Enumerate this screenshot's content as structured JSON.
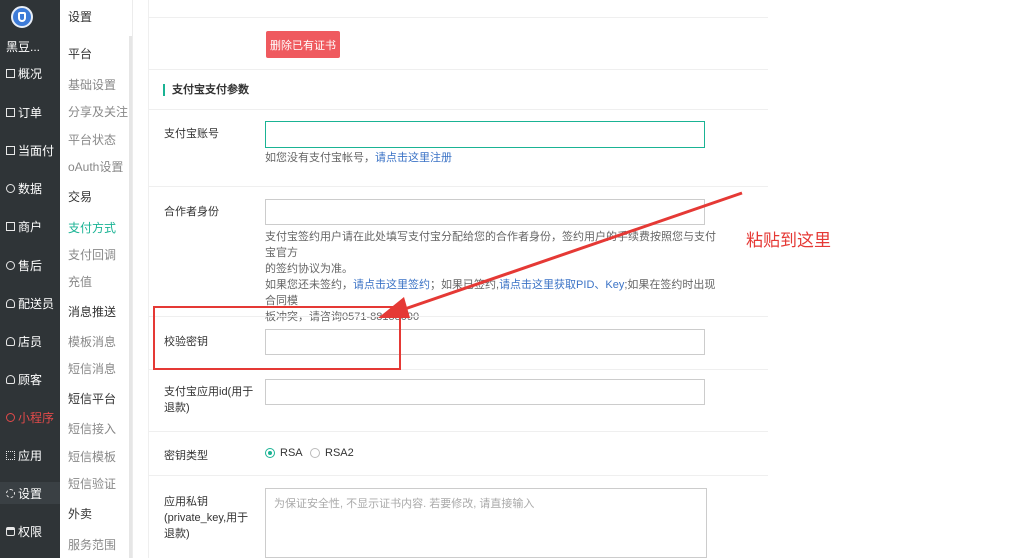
{
  "nav": {
    "shop_name": "黑豆...",
    "items": [
      {
        "label": "概况",
        "icon": "calendar-icon"
      },
      {
        "label": "订单",
        "icon": "list-icon"
      },
      {
        "label": "当面付",
        "icon": "list-icon"
      },
      {
        "label": "数据",
        "icon": "chart-icon"
      },
      {
        "label": "商户",
        "icon": "store-icon"
      },
      {
        "label": "售后",
        "icon": "service-icon"
      },
      {
        "label": "配送员",
        "icon": "user-icon"
      },
      {
        "label": "店员",
        "icon": "user-icon"
      },
      {
        "label": "顾客",
        "icon": "user-icon"
      },
      {
        "label": "小程序",
        "icon": "mini-program-icon"
      },
      {
        "label": "应用",
        "icon": "grid-icon"
      },
      {
        "label": "设置",
        "icon": "gear-icon"
      },
      {
        "label": "权限",
        "icon": "lock-icon"
      }
    ]
  },
  "subnav": {
    "title": "设置",
    "entries": [
      {
        "label": "平台",
        "type": "group"
      },
      {
        "label": "基础设置",
        "type": "item"
      },
      {
        "label": "分享及关注",
        "type": "item"
      },
      {
        "label": "平台状态",
        "type": "item"
      },
      {
        "label": "oAuth设置",
        "type": "item"
      },
      {
        "label": "交易",
        "type": "group"
      },
      {
        "label": "支付方式",
        "type": "item",
        "active": true
      },
      {
        "label": "支付回调",
        "type": "item"
      },
      {
        "label": "充值",
        "type": "item"
      },
      {
        "label": "消息推送",
        "type": "group"
      },
      {
        "label": "模板消息",
        "type": "item"
      },
      {
        "label": "短信消息",
        "type": "item"
      },
      {
        "label": "短信平台",
        "type": "group"
      },
      {
        "label": "短信接入",
        "type": "item"
      },
      {
        "label": "短信模板",
        "type": "item"
      },
      {
        "label": "短信验证",
        "type": "item"
      },
      {
        "label": "外卖",
        "type": "group"
      },
      {
        "label": "服务范围",
        "type": "item"
      }
    ]
  },
  "main": {
    "delete_button": "删除已有证书",
    "section_title": "支付宝支付参数",
    "account": {
      "label": "支付宝账号",
      "value": "",
      "help_prefix": "如您没有支付宝帐号，",
      "help_link": "请点击这里注册"
    },
    "partner": {
      "label": "合作者身份",
      "value": "",
      "help_line1": "支付宝签约用户请在此处填写支付宝分配给您的合作者身份，签约用户的手续费按照您与支付宝官方",
      "help_line2": "的签约协议为准。",
      "help_line3_prefix": "如果您还未签约，",
      "help_line3_link1": "请点击这里签约",
      "help_line3_mid": "；如果已签约,",
      "help_line3_link2": "请点击这里获取PID、Key",
      "help_line3_suffix": ";如果在签约时出现合同模",
      "help_line4": "板冲突，请咨询0571-88158090"
    },
    "secret": {
      "label": "校验密钥",
      "value": ""
    },
    "app_id": {
      "label_line1": "支付宝应用id(用于",
      "label_line2": "退款)",
      "value": ""
    },
    "key_type": {
      "label": "密钥类型",
      "options": [
        "RSA",
        "RSA2"
      ],
      "selected": "RSA"
    },
    "private_key": {
      "label_line1": "应用私钥",
      "label_line2": "(private_key,用于",
      "label_line3": "退款)",
      "placeholder": "为保证安全性, 不显示证书内容. 若要修改, 请直接输入"
    }
  },
  "annotation": {
    "text": "粘贴到这里",
    "color": "#e53935"
  }
}
